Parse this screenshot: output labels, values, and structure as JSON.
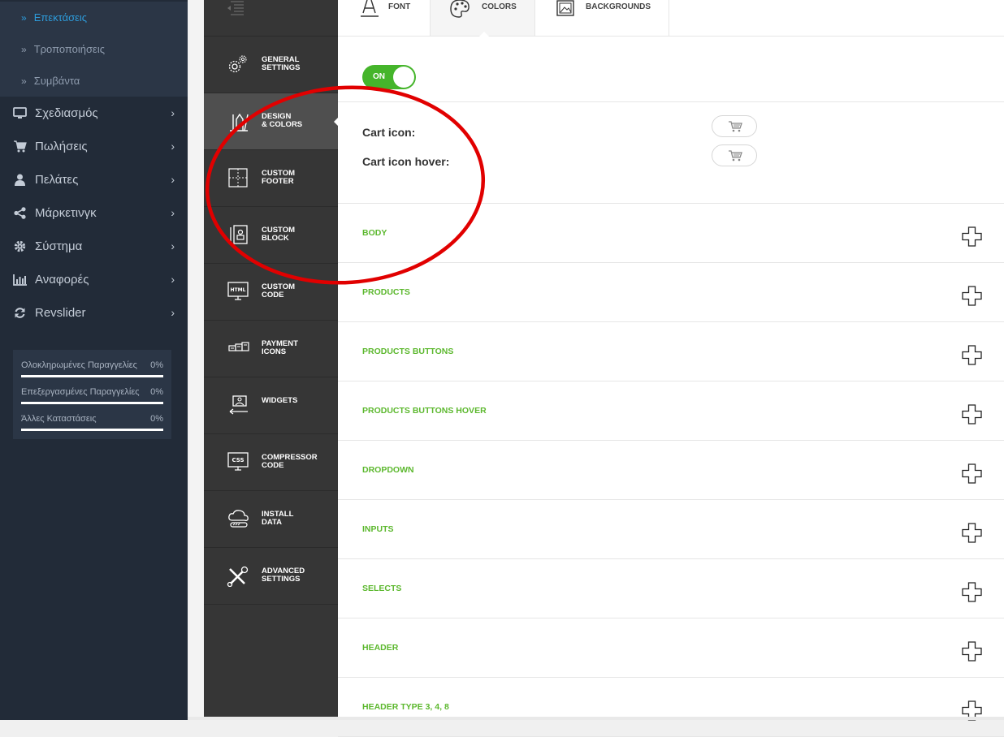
{
  "sidebar": {
    "sub_items": [
      {
        "label": "Επεκτάσεις",
        "active": true
      },
      {
        "label": "Τροποποιήσεις",
        "active": false
      },
      {
        "label": "Συμβάντα",
        "active": false
      }
    ],
    "items": [
      {
        "label": "Σχεδιασμός",
        "icon": "monitor-icon"
      },
      {
        "label": "Πωλήσεις",
        "icon": "cart-icon"
      },
      {
        "label": "Πελάτες",
        "icon": "user-icon"
      },
      {
        "label": "Μάρκετινγκ",
        "icon": "share-icon"
      },
      {
        "label": "Σύστημα",
        "icon": "gear-icon"
      },
      {
        "label": "Αναφορές",
        "icon": "bar-chart-icon"
      },
      {
        "label": "Revslider",
        "icon": "refresh-icon"
      }
    ],
    "stats": [
      {
        "label": "Ολοκληρωμένες Παραγγελίες",
        "value": "0%"
      },
      {
        "label": "Επεξεργασμένες Παραγγελίες",
        "value": "0%"
      },
      {
        "label": "Άλλες Καταστάσεις",
        "value": "0%"
      }
    ]
  },
  "module_menu": {
    "items": [
      {
        "label": "General\nSettings",
        "icon": "gears-icon",
        "active": false
      },
      {
        "label": "Design\n& Colors",
        "icon": "design-tools-icon",
        "active": true
      },
      {
        "label": "Custom\nFooter",
        "icon": "footer-layout-icon",
        "active": false
      },
      {
        "label": "Custom\nBlock",
        "icon": "block-icon",
        "active": false
      },
      {
        "label": "Custom\nCode",
        "icon": "html-monitor-icon",
        "active": false
      },
      {
        "label": "Payment\nIcons",
        "icon": "payment-cards-icon",
        "active": false
      },
      {
        "label": "Widgets",
        "icon": "widget-icon",
        "active": false
      },
      {
        "label": "Compressor\nCode",
        "icon": "css-monitor-icon",
        "active": false
      },
      {
        "label": "Install\nData",
        "icon": "cloud-install-icon",
        "active": false
      },
      {
        "label": "Advanced\nSettings",
        "icon": "tools-icon",
        "active": false
      }
    ]
  },
  "tabs": [
    {
      "label": "Font",
      "icon": "font-icon",
      "active": false
    },
    {
      "label": "Colors",
      "icon": "palette-icon",
      "active": true
    },
    {
      "label": "Backgrounds",
      "icon": "image-frame-icon",
      "active": false
    }
  ],
  "toggle": {
    "label": "ON",
    "state": "on"
  },
  "cart": {
    "icon_label": "Cart icon:",
    "hover_label": "Cart icon hover:"
  },
  "sections": [
    "BODY",
    "PRODUCTS",
    "PRODUCTS BUTTONS",
    "PRODUCTS BUTTONS HOVER",
    "DROPDOWN",
    "INPUTS",
    "SELECTS",
    "HEADER",
    "HEADER TYPE 3, 4, 8"
  ],
  "colors": {
    "sidebar_bg": "#222b38",
    "module_menu_bg": "#363636",
    "accent_green": "#5cb82e",
    "toggle_green": "#45b52b",
    "active_link": "#2d9cdb",
    "annotation_red": "#e10000"
  }
}
